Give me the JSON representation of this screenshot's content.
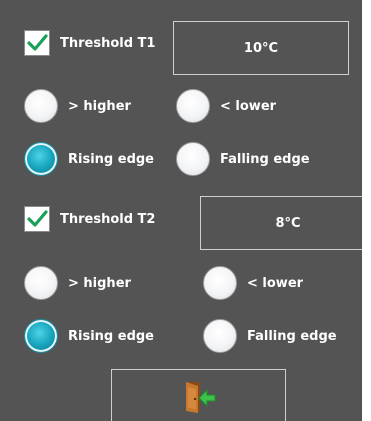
{
  "threshold1": {
    "label": "Threshold T1",
    "checked": true,
    "value": "10°C",
    "options_row1": [
      "> higher",
      "< lower"
    ],
    "options_row2": [
      "Rising edge",
      "Falling edge"
    ],
    "selected": "Rising edge"
  },
  "threshold2": {
    "label": "Threshold T2",
    "checked": true,
    "value": "8°C",
    "options_row1": [
      "> higher",
      "< lower"
    ],
    "options_row2": [
      "Rising edge",
      "Falling edge"
    ],
    "selected": "Rising edge"
  },
  "exit_button": {
    "icon": "exit-door-icon"
  },
  "colors": {
    "panel_bg": "#545454",
    "checkmark": "#1aa05a",
    "radio_selected": "#19a8c0",
    "exit_arrow": "#3cc24a",
    "door": "#c8782e"
  }
}
